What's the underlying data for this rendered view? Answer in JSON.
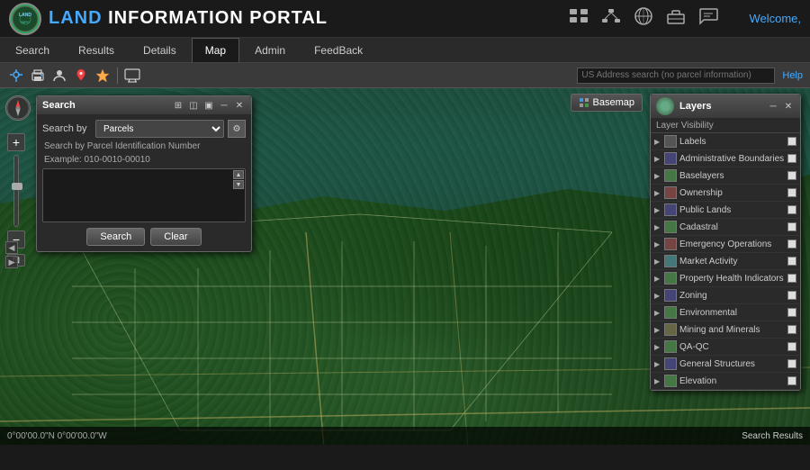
{
  "header": {
    "logo_circle_text": "LIP",
    "logo_land": "LAND",
    "logo_rest": " INFORMATION PORTAL",
    "welcome_text": "Welcome,"
  },
  "nav": {
    "tabs": [
      {
        "label": "Search",
        "active": false
      },
      {
        "label": "Results",
        "active": false
      },
      {
        "label": "Details",
        "active": false
      },
      {
        "label": "Map",
        "active": true
      },
      {
        "label": "Admin",
        "active": false
      },
      {
        "label": "FeedBack",
        "active": false
      }
    ]
  },
  "toolbar": {
    "address_placeholder": "US Address search (no parcel information)",
    "help_label": "Help"
  },
  "search_widget": {
    "title": "Search",
    "search_by_label": "Search by",
    "search_by_value": "Parcels",
    "hint": "Search by Parcel Identification Number",
    "example": "Example: 010-0010-00010",
    "search_btn": "Search",
    "clear_btn": "Clear"
  },
  "layers_panel": {
    "title": "Layers",
    "visibility_label": "Layer Visibility",
    "layers": [
      {
        "name": "Labels",
        "color": "#555"
      },
      {
        "name": "Administrative Boundaries",
        "color": "#447"
      },
      {
        "name": "Baselayers",
        "color": "#474"
      },
      {
        "name": "Ownership",
        "color": "#744"
      },
      {
        "name": "Public Lands",
        "color": "#447"
      },
      {
        "name": "Cadastral",
        "color": "#474"
      },
      {
        "name": "Emergency Operations",
        "color": "#744"
      },
      {
        "name": "Market Activity",
        "color": "#477"
      },
      {
        "name": "Property Health Indicators",
        "color": "#474"
      },
      {
        "name": "Zoning",
        "color": "#447"
      },
      {
        "name": "Environmental",
        "color": "#474"
      },
      {
        "name": "Mining and Minerals",
        "color": "#664"
      },
      {
        "name": "QA-QC",
        "color": "#474"
      },
      {
        "name": "General Structures",
        "color": "#447"
      },
      {
        "name": "Elevation",
        "color": "#474"
      }
    ]
  },
  "basemap": {
    "label": "Basemap"
  },
  "status_bar": {
    "coords": "0°00'00.0\"N 0°00'00.0\"W",
    "search_results": "Search Results"
  },
  "icons": {
    "departments": "⊞",
    "users": "⊟",
    "globe": "🌐",
    "briefcase": "💼",
    "chat": "💬",
    "zoom_in": "+",
    "zoom_out": "−",
    "nav_up": "▲",
    "nav_down": "▼",
    "nav_left": "◀",
    "nav_right": "▶",
    "close": "✕",
    "minimize": "─",
    "menu_dots": "⋮"
  }
}
